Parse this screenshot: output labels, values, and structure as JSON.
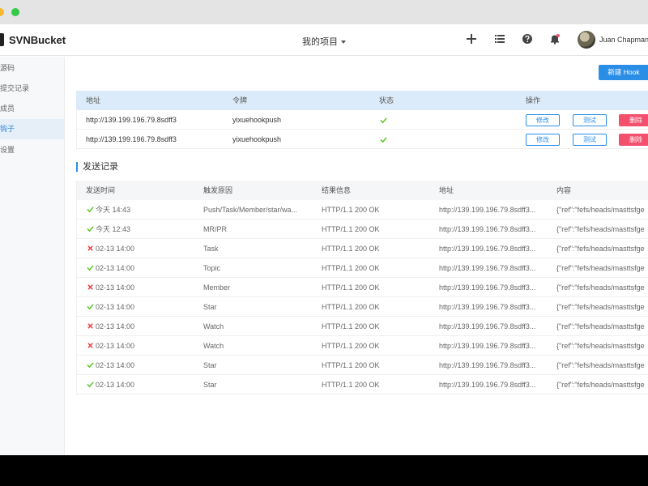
{
  "header": {
    "logo_text": "SVNBucket",
    "project_label": "我的项目",
    "username": "Juan Chapman"
  },
  "sidebar": {
    "items": [
      {
        "label": "源码",
        "active": false
      },
      {
        "label": "提交记录",
        "active": false
      },
      {
        "label": "成员",
        "active": false
      },
      {
        "label": "钩子",
        "active": true
      },
      {
        "label": "设置",
        "active": false
      }
    ]
  },
  "toolbar": {
    "new_hook_label": "新建 Hook"
  },
  "hooks": {
    "headers": [
      "地址",
      "令牌",
      "状态",
      "操作"
    ],
    "rows": [
      {
        "url": "http://139.199.196.79.8sdff3",
        "token": "yixuehookpush",
        "status": "ok"
      },
      {
        "url": "http://139.199.196.79.8sdff3",
        "token": "yixuehookpush",
        "status": "ok"
      }
    ],
    "edit_label": "修改",
    "test_label": "测试",
    "delete_label": "删除"
  },
  "logs": {
    "title": "发送记录",
    "headers": [
      "发送时间",
      "触发原因",
      "结果信息",
      "地址",
      "内容"
    ],
    "rows": [
      {
        "status": "ok",
        "time": "今天 14:43",
        "reason": "Push/Task/Member/star/wa...",
        "result": "HTTP/1.1 200 OK",
        "url": "http://139.199.196.79.8sdff3...",
        "content": "{\"ref\":\"fefs/heads/masttsfge"
      },
      {
        "status": "ok",
        "time": "今天 12:43",
        "reason": "MR/PR",
        "result": "HTTP/1.1 200 OK",
        "url": "http://139.199.196.79.8sdff3...",
        "content": "{\"ref\":\"fefs/heads/masttsfge"
      },
      {
        "status": "fail",
        "time": "02-13 14:00",
        "reason": "Task",
        "result": "HTTP/1.1 200 OK",
        "url": "http://139.199.196.79.8sdff3...",
        "content": "{\"ref\":\"fefs/heads/masttsfge"
      },
      {
        "status": "ok",
        "time": "02-13 14:00",
        "reason": "Topic",
        "result": "HTTP/1.1 200 OK",
        "url": "http://139.199.196.79.8sdff3...",
        "content": "{\"ref\":\"fefs/heads/masttsfge"
      },
      {
        "status": "fail",
        "time": "02-13 14:00",
        "reason": "Member",
        "result": "HTTP/1.1 200 OK",
        "url": "http://139.199.196.79.8sdff3...",
        "content": "{\"ref\":\"fefs/heads/masttsfge"
      },
      {
        "status": "ok",
        "time": "02-13 14:00",
        "reason": "Star",
        "result": "HTTP/1.1 200 OK",
        "url": "http://139.199.196.79.8sdff3...",
        "content": "{\"ref\":\"fefs/heads/masttsfge"
      },
      {
        "status": "fail",
        "time": "02-13 14:00",
        "reason": "Watch",
        "result": "HTTP/1.1 200 OK",
        "url": "http://139.199.196.79.8sdff3...",
        "content": "{\"ref\":\"fefs/heads/masttsfge"
      },
      {
        "status": "fail",
        "time": "02-13 14:00",
        "reason": "Watch",
        "result": "HTTP/1.1 200 OK",
        "url": "http://139.199.196.79.8sdff3...",
        "content": "{\"ref\":\"fefs/heads/masttsfge"
      },
      {
        "status": "ok",
        "time": "02-13 14:00",
        "reason": "Star",
        "result": "HTTP/1.1 200 OK",
        "url": "http://139.199.196.79.8sdff3...",
        "content": "{\"ref\":\"fefs/heads/masttsfge"
      },
      {
        "status": "ok",
        "time": "02-13 14:00",
        "reason": "Star",
        "result": "HTTP/1.1 200 OK",
        "url": "http://139.199.196.79.8sdff3...",
        "content": "{\"ref\":\"fefs/heads/masttsfge"
      }
    ]
  },
  "colors": {
    "accent": "#2b8ee6",
    "success": "#52c41a",
    "danger": "#f2506d"
  }
}
